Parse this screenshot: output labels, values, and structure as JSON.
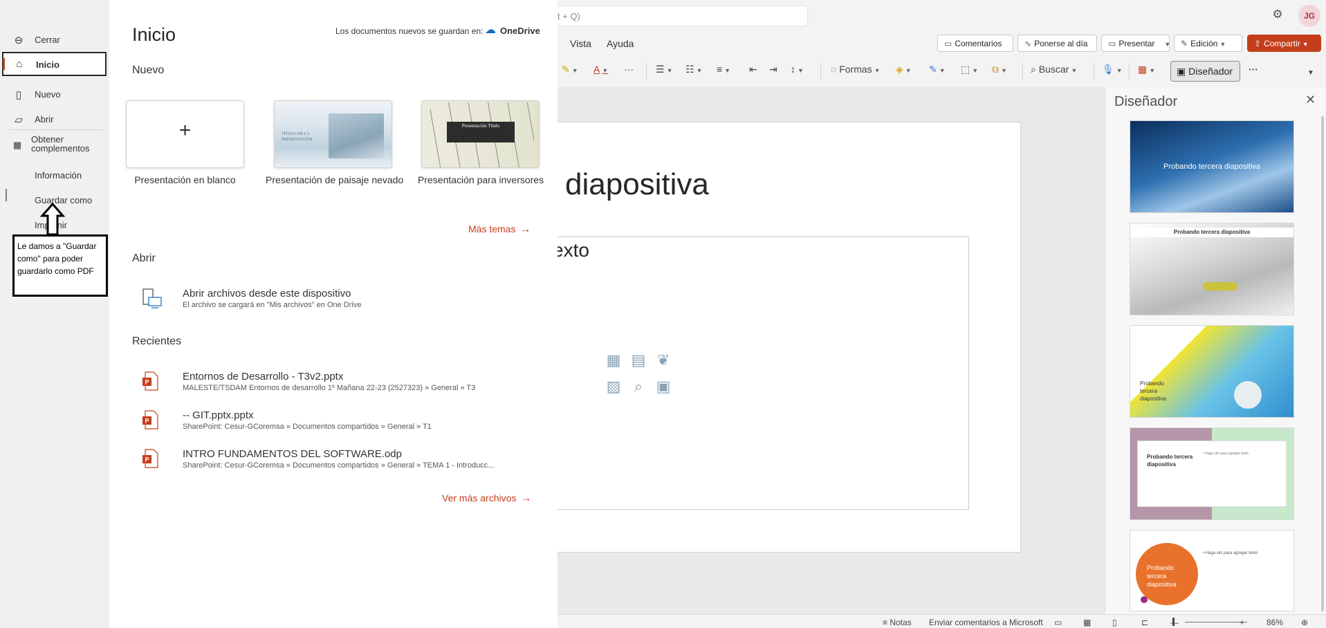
{
  "app": {
    "search_placeholder": "t + Q)",
    "avatar_initials": "JG",
    "accent_color": "#c43e1c"
  },
  "menu": {
    "vista": "Vista",
    "ayuda": "Ayuda"
  },
  "actions": {
    "comentarios": "Comentarios",
    "ponerse_al_dia": "Ponerse al día",
    "presentar": "Presentar",
    "edicion": "Edición",
    "compartir": "Compartir"
  },
  "ribbon": {
    "formas": "Formas",
    "buscar": "Buscar",
    "disenador": "Diseñador",
    "more": "···"
  },
  "slide": {
    "title_fragment": "diapositiva",
    "text_fragment": "exto"
  },
  "designer": {
    "title": "Diseñador",
    "thumbs": [
      {
        "label": "Probando tercera diapositiva"
      },
      {
        "label": "Probando tercera diapositiva"
      },
      {
        "label": "Probando tercera diapositiva"
      },
      {
        "label": "Probando tercera diapositiva",
        "sub": "• Haga clic para agregar texto"
      },
      {
        "label": "Probando tercera diapositiva",
        "sub": "• Haga clic para agregar texto"
      }
    ]
  },
  "statusbar": {
    "notas": "Notas",
    "feedback": "Enviar comentarios a Microsoft",
    "zoom": "86%"
  },
  "backstage": {
    "nav": {
      "cerrar": "Cerrar",
      "inicio": "Inicio",
      "nuevo": "Nuevo",
      "abrir": "Abrir",
      "obtener_complementos": "Obtener complementos",
      "informacion": "Información",
      "guardar_como": "Guardar como",
      "imprimir": "Imprimir"
    },
    "annotation": "Le damos a \"Guardar como\" para poder guardarlo como PDF",
    "title": "Inicio",
    "saved_in": "Los documentos nuevos se guardan en:",
    "onedrive": "OneDrive",
    "nuevo_heading": "Nuevo",
    "templates": [
      {
        "caption": "Presentación en blanco"
      },
      {
        "caption": "Presentación de paisaje nevado",
        "inner_title": "TÍTULO DE LA PRESENTACIÓN"
      },
      {
        "caption": "Presentación para inversores",
        "inner_title": "Presentación Título"
      }
    ],
    "mas_temas": "Más temas",
    "abrir_heading": "Abrir",
    "open_device": {
      "title": "Abrir archivos desde este dispositivo",
      "subtitle": "El archivo se cargará en \"Mis archivos\" en One Drive"
    },
    "recientes_heading": "Recientes",
    "recent_files": [
      {
        "name": "Entornos de Desarrollo - T3v2.pptx",
        "path": "MALESTE/TSDAM Entornos de desarrollo 1º Mañana 22-23 (2527323) » General » T3"
      },
      {
        "name": "-- GIT.pptx.pptx",
        "path": "SharePoint: Cesur-GCoremsa » Documentos compartidos » General » T1"
      },
      {
        "name": "INTRO FUNDAMENTOS DEL SOFTWARE.odp",
        "path": "SharePoint: Cesur-GCoremsa » Documentos compartidos » General » TEMA 1 - Introducc..."
      }
    ],
    "ver_mas": "Ver más archivos"
  }
}
